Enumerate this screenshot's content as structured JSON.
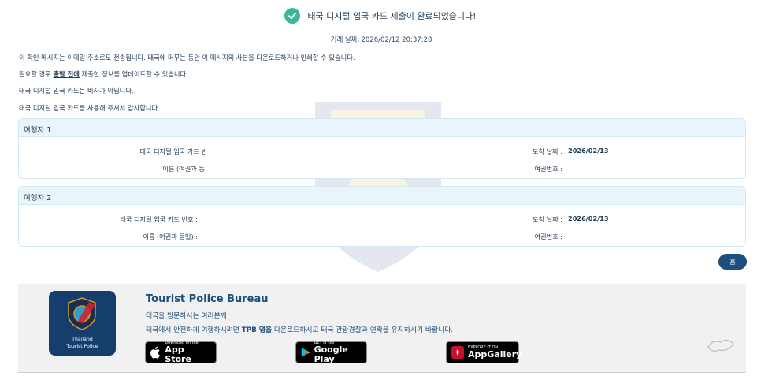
{
  "header": {
    "success_message": "태국 디지털 입국 카드 제출이 완료되었습니다!",
    "transaction_label": "거래 날짜:",
    "transaction_date": "2026/02/12 20:37:28"
  },
  "messages": {
    "line1": "이 확인 메시지는 이메일 주소로도 전송됩니다. 태국에 머무는 동안 이 메시지의 사본을 다운로드하거나 인쇄할 수 있습니다.",
    "line2_prefix": "필요할 경우 ",
    "line2_bold": "출발 전에",
    "line2_suffix": " 제출한 정보를 업데이트할 수 있습니다.",
    "line3": "태국 디지털 입국 카드는 비자가 아닙니다.",
    "line4": "태국 디지털 입국 카드를 사용해 주셔서 감사합니다."
  },
  "travelers": [
    {
      "title": "여행자 1",
      "card_label": "태국 디지털 입국 카드 번호 :",
      "name_label": "이름 (여권과 동일) :",
      "arrival_label": "도착 날짜 :",
      "arrival_date": "2026/02/13",
      "passport_label": "여권번호 :"
    },
    {
      "title": "여행자 2",
      "card_label": "태국 디지털 입국 카드 번호 :",
      "name_label": "이름 (여권과 동일) :",
      "arrival_label": "도착 날짜 :",
      "arrival_date": "2026/02/13",
      "passport_label": "여권번호 :"
    }
  ],
  "home_button": "홈",
  "footer": {
    "tile_line1": "Thailand",
    "tile_line2": "Tourist Police",
    "title": "Tourist Police Bureau",
    "subtitle": "태국을 방문하시는 여러분께",
    "desc_prefix": "태국에서 안전하게 여행하시려면 ",
    "desc_bold": "TPB 앱을",
    "desc_suffix": " 다운로드하시고 태국 관광경찰과 연락을 유지하시기 바랍니다.",
    "stores": [
      {
        "small": "Download on the",
        "big": "App Store",
        "icon": "apple-icon"
      },
      {
        "small": "GET IT ON",
        "big": "Google Play",
        "icon": "google-play-icon"
      },
      {
        "small": "EXPLORE IT ON",
        "big": "AppGallery",
        "icon": "huawei-icon"
      }
    ]
  },
  "colors": {
    "accent": "#1d4f7e",
    "success": "#3db69a",
    "panel_header": "#e9f4fb",
    "footer_bg": "#f1f1f1"
  }
}
